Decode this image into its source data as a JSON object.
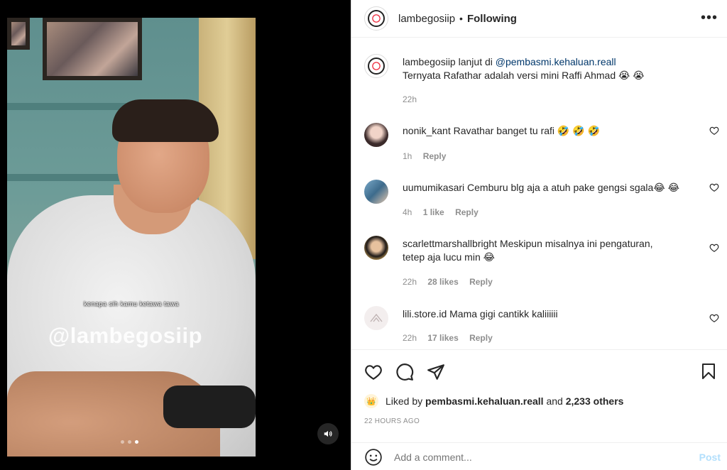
{
  "video": {
    "caption": "kenapa sih kamu ketawa tawa",
    "watermark": "@lambegosiip",
    "slide_count": 3,
    "active_slide": 3,
    "sound_icon": "speaker-icon"
  },
  "header": {
    "username": "lambegosiip",
    "separator": "•",
    "follow_state": "Following",
    "more_icon": "more-options-icon"
  },
  "post": {
    "username": "lambegosiip",
    "text_before": "lanjut di",
    "mention": "@pembasmi.kehaluan.reall",
    "line2": "Ternyata Rafathar adalah versi mini Raffi Ahmad 😭 😭",
    "time": "22h"
  },
  "comments": [
    {
      "username": "nonik_kant",
      "text": "Ravathar banget tu rafi 🤣 🤣 🤣",
      "time": "1h",
      "likes": "",
      "reply": "Reply"
    },
    {
      "username": "uumumikasari",
      "text": "Cemburu blg aja a atuh pake gengsi sgala😂 😂",
      "time": "4h",
      "likes": "1 like",
      "reply": "Reply"
    },
    {
      "username": "scarlettmarshallbright",
      "text": "Meskipun misalnya ini pengaturan,",
      "text2": "tetep aja lucu min 😂",
      "time": "22h",
      "likes": "28 likes",
      "reply": "Reply"
    },
    {
      "username": "lili.store.id",
      "text": "Mama gigi cantikk kaliiiiii",
      "time": "22h",
      "likes": "17 likes",
      "reply": "Reply"
    }
  ],
  "actions": {
    "liked_by_prefix": "Liked by",
    "liked_by_user": "pembasmi.kehaluan.reall",
    "and": "and",
    "others": "2,233 others",
    "timestamp": "22 HOURS AGO"
  },
  "add_comment": {
    "placeholder": "Add a comment...",
    "post_label": "Post"
  },
  "colors": {
    "mention": "#00376b",
    "meta": "#8e8e8e",
    "post_disabled": "#b2dffc"
  }
}
